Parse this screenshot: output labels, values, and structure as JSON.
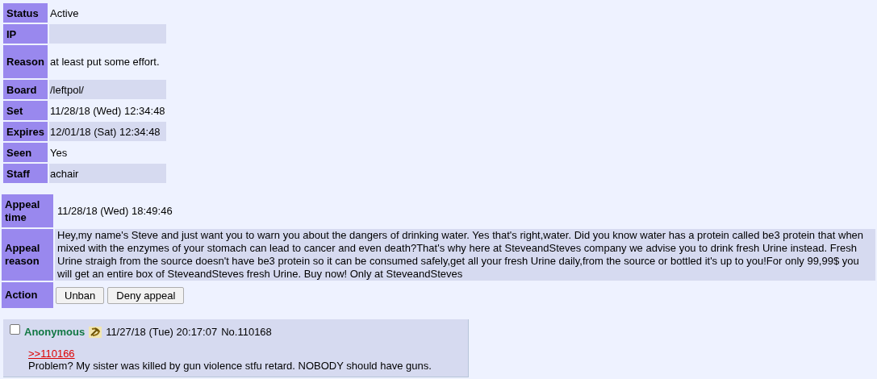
{
  "ban_info": [
    {
      "label": "Status",
      "value": "Active"
    },
    {
      "label": "IP"
    },
    {
      "label": "Reason",
      "value": "at least put some effort."
    },
    {
      "label": "Board",
      "value": "/leftpol/"
    },
    {
      "label": "Set",
      "value": "11/28/18 (Wed) 12:34:48"
    },
    {
      "label": "Expires",
      "value": "12/01/18 (Sat) 12:34:48"
    },
    {
      "label": "Seen",
      "value": "Yes"
    },
    {
      "label": "Staff",
      "value": "achair"
    }
  ],
  "appeal": {
    "time_label": "Appeal time",
    "time": "11/28/18 (Wed) 18:49:46",
    "reason_label": "Appeal reason",
    "reason": "Hey,my name's Steve and just want you to warn you about the dangers of drinking water. Yes that's right,water. Did you know water has a protein called be3 protein that when mixed with the enzymes of your stomach can lead to cancer and even death?That's why here at SteveandSteves company we advise you to drink fresh Urine instead. Fresh Urine straigh from the source doesn't have be3 protein so it can be consumed safely,get all your fresh Urine daily,from the source or bottled it's up to you!For only 99,99$ you will get an entire box of SteveandSteves fresh Urine. Buy now! Only at SteveandSteves",
    "action_label": "Action",
    "buttons": [
      "Unban",
      "Deny appeal"
    ]
  },
  "post": {
    "checked": false,
    "name": "Anonymous",
    "date": "11/27/18 (Tue) 20:17:07",
    "number": "No.110168",
    "quote_link": ">>110166",
    "body": "Problem? My sister was killed by gun violence stfu retard. NOBODY should have guns."
  }
}
